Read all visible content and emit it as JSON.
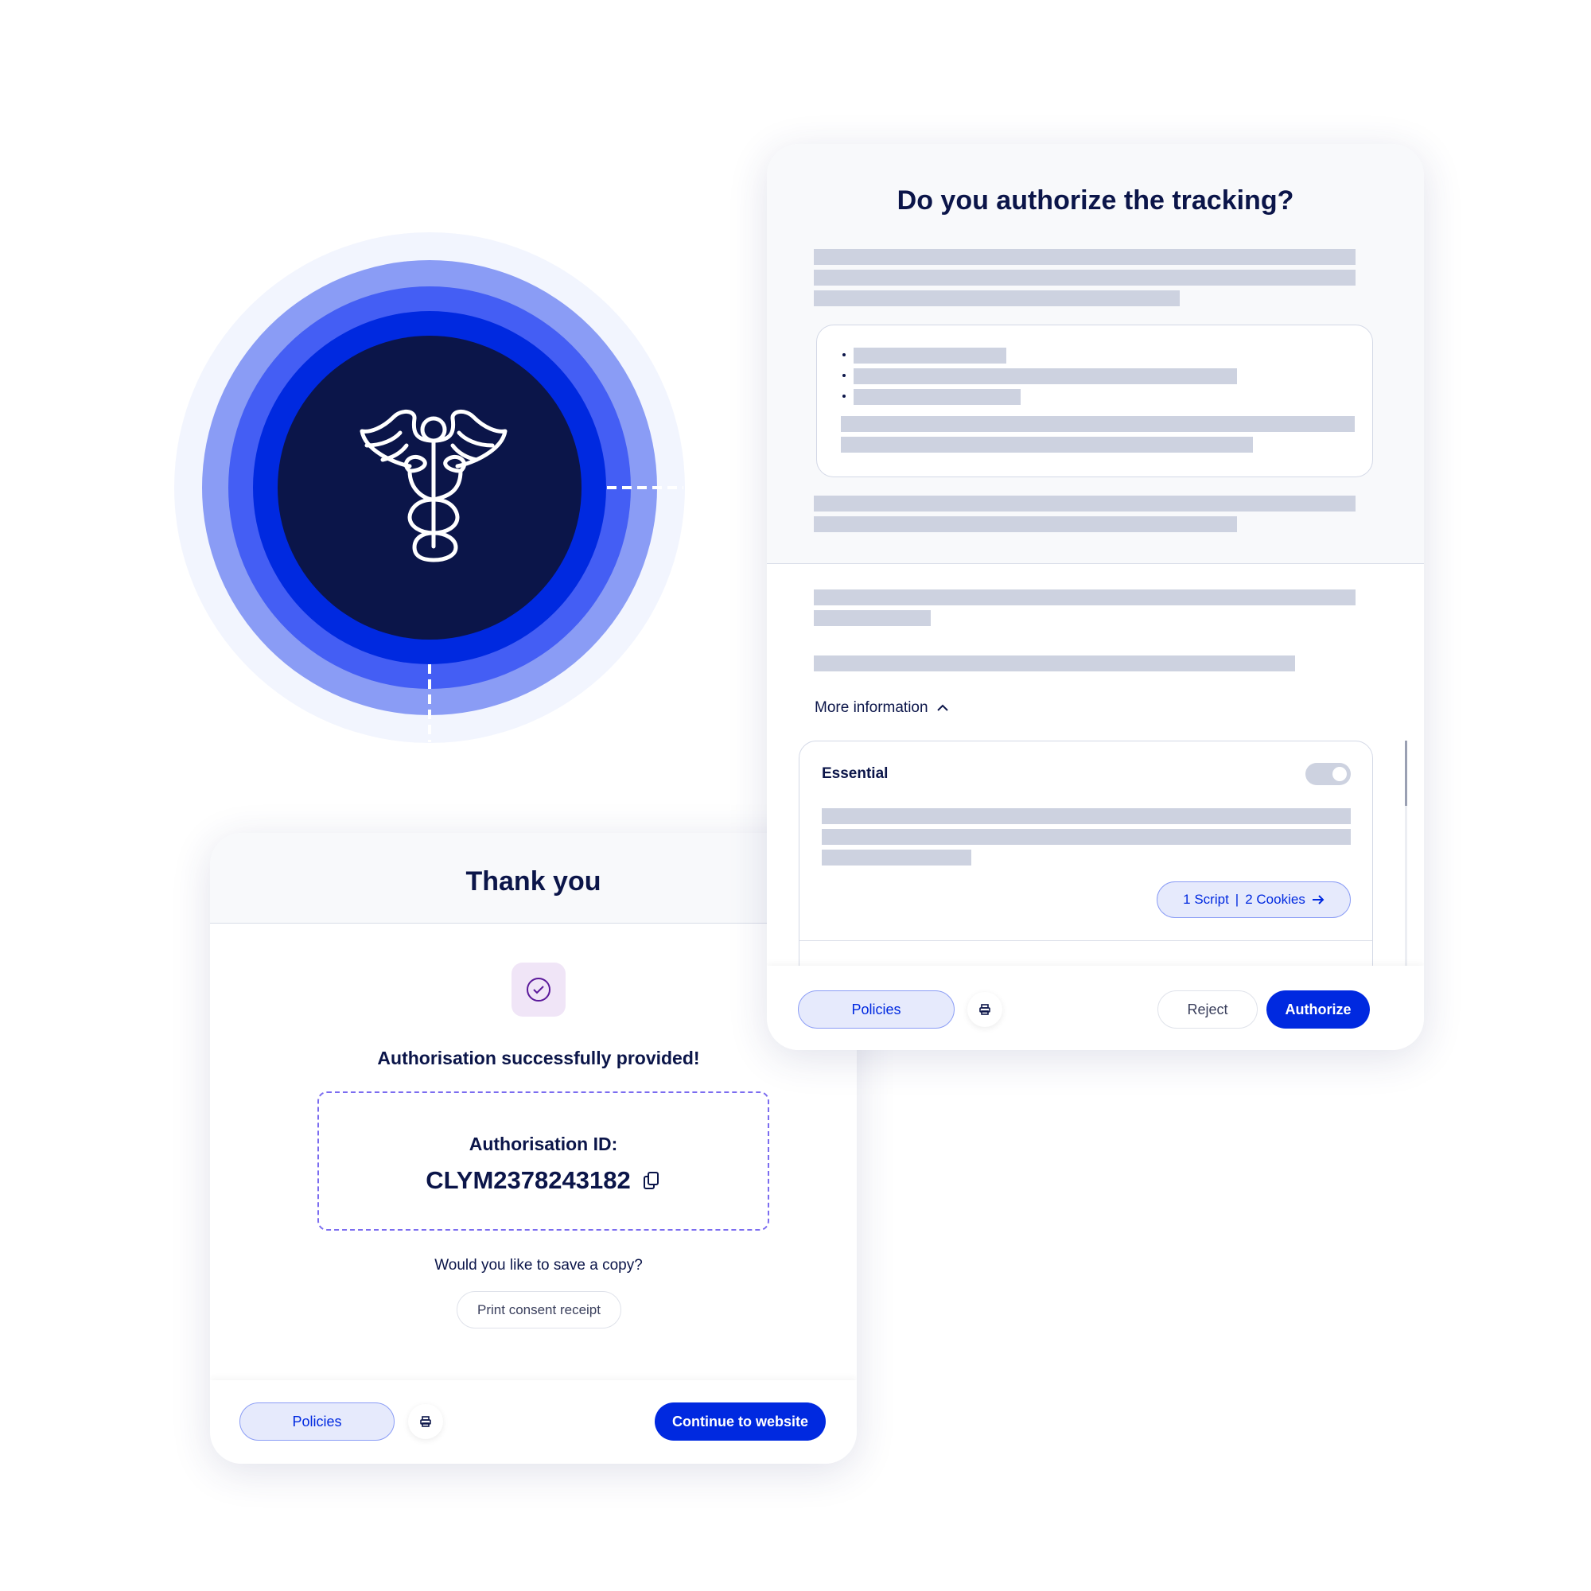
{
  "colors": {
    "navy": "#0b1549",
    "primary": "#0029e0",
    "chip_bg": "#e6eafc",
    "skeleton": "#cdd2e0"
  },
  "illustration": {
    "icon": "caduceus-icon"
  },
  "consent_card": {
    "title": "Do you authorize the tracking?",
    "more_info_label": "More information",
    "essential": {
      "label": "Essential",
      "toggle_on": true,
      "chip_script": "1 Script",
      "chip_sep": "|",
      "chip_cookies": "2 Cookies"
    },
    "footer": {
      "policies": "Policies",
      "reject": "Reject",
      "authorize": "Authorize"
    }
  },
  "thanks_card": {
    "title": "Thank you",
    "success": "Authorisation successfully provided!",
    "id_label": "Authorisation ID:",
    "id_value": "CLYM2378243182",
    "save_prompt": "Would you like to save a copy?",
    "print_receipt": "Print consent receipt",
    "footer": {
      "policies": "Policies",
      "continue": "Continue to website"
    }
  }
}
